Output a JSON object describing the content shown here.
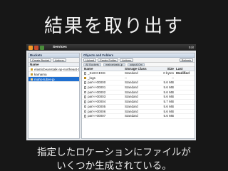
{
  "slide": {
    "title": "結果を取り出す",
    "caption_line1": "指定したロケーションにファイルが",
    "caption_line2": "いくつか生成されている。"
  },
  "console": {
    "services_label": "Services",
    "topbar_right": "Edit",
    "buckets_panel": {
      "title": "Buckets",
      "create_button": "Create Bucket",
      "actions_button": "Actions",
      "column_header": "Name",
      "items": [
        {
          "label": "elasticbeanstalk-ap-northeast-1",
          "selected": false
        },
        {
          "label": "kamama",
          "selected": false
        },
        {
          "label": "maho-tuber-jp",
          "selected": true
        }
      ]
    },
    "objects_panel": {
      "title": "Objects and Folders",
      "buttons": [
        "Upload",
        "Create Folder",
        "Actions"
      ],
      "refresh_label": "Refresh",
      "breadcrumbs": [
        "All Buckets",
        "mahoelastic-jp",
        "output10m"
      ],
      "columns": [
        "Name",
        "Storage Class",
        "Size",
        "Last Modified"
      ],
      "rows": [
        {
          "name": "_SUCCESS",
          "class": "Standard",
          "size": "0 bytes",
          "folder": false
        },
        {
          "name": "_logs",
          "class": "--",
          "size": "--",
          "folder": true
        },
        {
          "name": "part-r-00000",
          "class": "Standard",
          "size": "5.6 MB",
          "folder": false
        },
        {
          "name": "part-r-00001",
          "class": "Standard",
          "size": "5.6 MB",
          "folder": false
        },
        {
          "name": "part-r-00002",
          "class": "Standard",
          "size": "5.6 MB",
          "folder": false
        },
        {
          "name": "part-r-00003",
          "class": "Standard",
          "size": "5.6 MB",
          "folder": false
        },
        {
          "name": "part-r-00004",
          "class": "Standard",
          "size": "5.7 MB",
          "folder": false
        },
        {
          "name": "part-r-00005",
          "class": "Standard",
          "size": "5.6 MB",
          "folder": false
        },
        {
          "name": "part-r-00006",
          "class": "Standard",
          "size": "5.6 MB",
          "folder": false
        },
        {
          "name": "part-r-00007",
          "class": "Standard",
          "size": "5.6 MB",
          "folder": false
        }
      ]
    }
  },
  "colors": {
    "background": "#171717",
    "selection": "#1f6fd0"
  }
}
